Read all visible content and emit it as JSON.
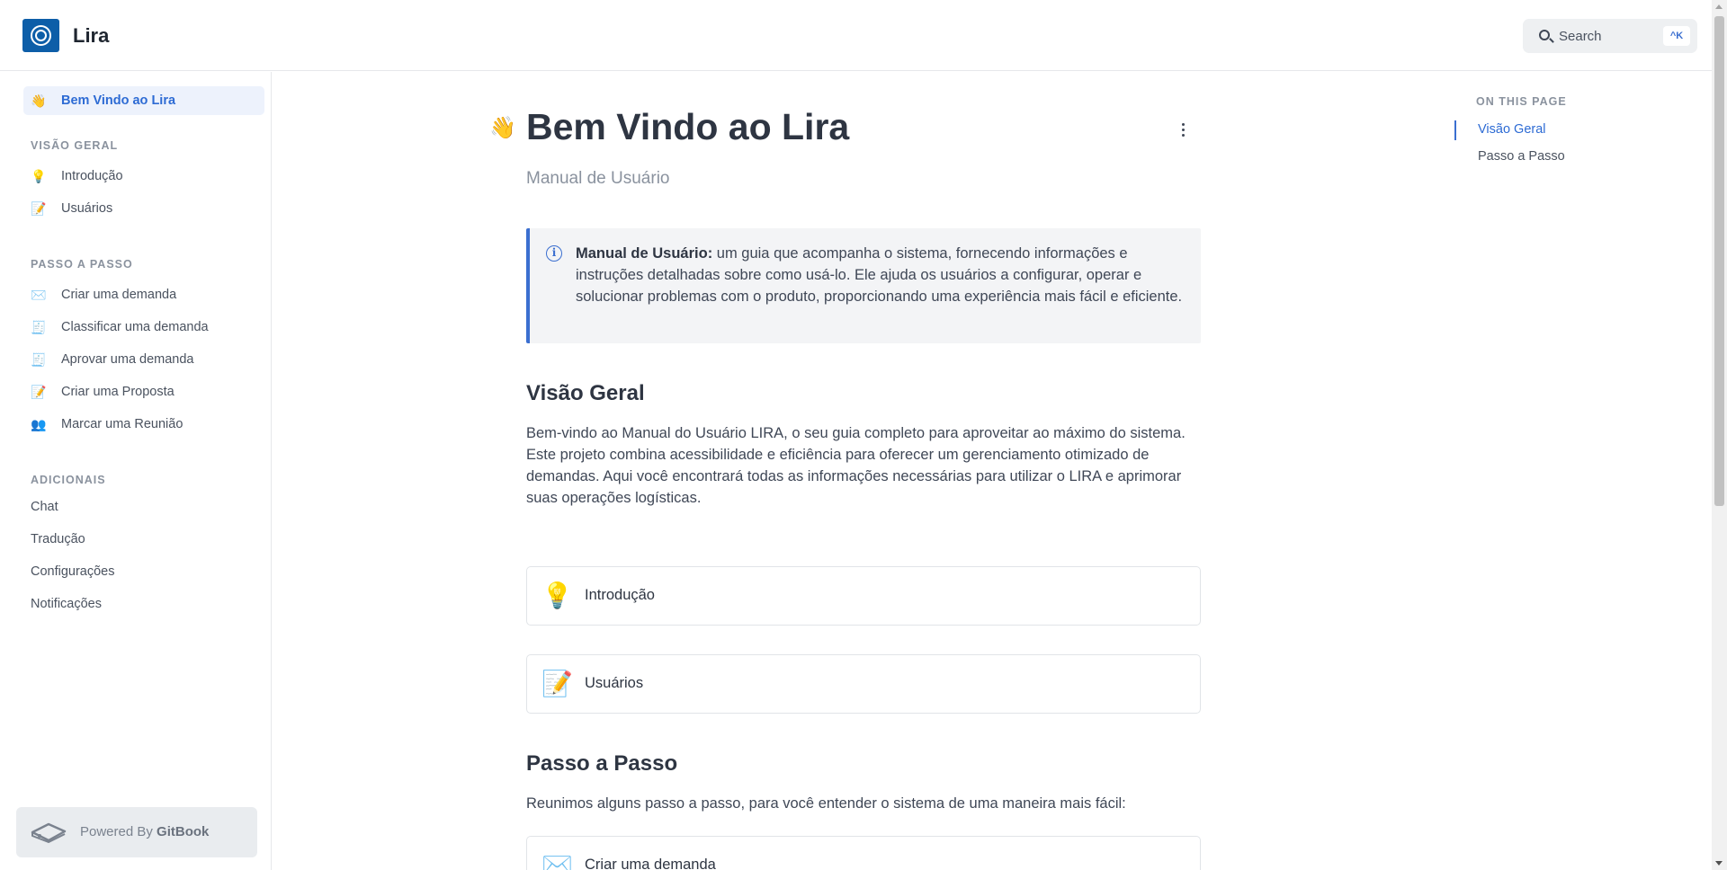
{
  "header": {
    "app_title": "Lira",
    "search_placeholder": "Search",
    "search_shortcut": "^K"
  },
  "sidebar": {
    "top_item": {
      "icon": "waving-hand-icon",
      "emoji": "👋",
      "label": "Bem Vindo ao Lira"
    },
    "sections": [
      {
        "title": "VISÃO GERAL",
        "items": [
          {
            "icon": "light-bulb-icon",
            "emoji": "💡",
            "label": "Introdução"
          },
          {
            "icon": "memo-icon",
            "emoji": "📝",
            "label": "Usuários"
          }
        ]
      },
      {
        "title": "PASSO A PASSO",
        "items": [
          {
            "icon": "envelope-icon",
            "emoji": "✉️",
            "label": "Criar uma demanda"
          },
          {
            "icon": "receipt-icon",
            "emoji": "🧾",
            "label": "Classificar uma demanda"
          },
          {
            "icon": "receipt-icon",
            "emoji": "🧾",
            "label": "Aprovar uma demanda"
          },
          {
            "icon": "memo-icon",
            "emoji": "📝",
            "label": "Criar uma Proposta"
          },
          {
            "icon": "people-icon",
            "emoji": "👥",
            "label": "Marcar uma Reunião"
          }
        ]
      },
      {
        "title": "ADICIONAIS",
        "items": [
          {
            "label": "Chat"
          },
          {
            "label": "Tradução"
          },
          {
            "label": "Configurações"
          },
          {
            "label": "Notificações"
          }
        ]
      }
    ],
    "powered_by": {
      "prefix": "Powered By ",
      "brand": "GitBook"
    }
  },
  "main": {
    "title_emoji": "👋",
    "title": "Bem Vindo ao Lira",
    "subtitle": "Manual de Usuário",
    "hint": {
      "bold": "Manual de Usuário:",
      "text": " um guia que acompanha o sistema, fornecendo informações e instruções detalhadas sobre como usá-lo. Ele ajuda os usuários a configurar, operar e solucionar problemas com o produto, proporcionando uma experiência mais fácil e eficiente."
    },
    "section1": {
      "heading": "Visão Geral",
      "paragraph": "Bem-vindo ao Manual do Usuário LIRA, o seu guia completo para aproveitar ao máximo do sistema. Este projeto combina acessibilidade e eficiência para oferecer um gerenciamento otimizado de demandas. Aqui você encontrará todas as informações necessárias para utilizar o LIRA e aprimorar suas operações logísticas."
    },
    "cards1": [
      {
        "icon": "light-bulb-icon",
        "emoji": "💡",
        "label": "Introdução"
      },
      {
        "icon": "memo-icon",
        "emoji": "📝",
        "label": "Usuários"
      }
    ],
    "section2": {
      "heading": "Passo a Passo",
      "paragraph": "Reunimos alguns passo a passo, para você entender o sistema de uma maneira mais fácil:"
    },
    "cards2": [
      {
        "icon": "envelope-icon",
        "emoji": "✉️",
        "label": "Criar uma demanda"
      }
    ]
  },
  "toc": {
    "heading": "ON THIS PAGE",
    "items": [
      "Visão Geral",
      "Passo a Passo"
    ]
  }
}
